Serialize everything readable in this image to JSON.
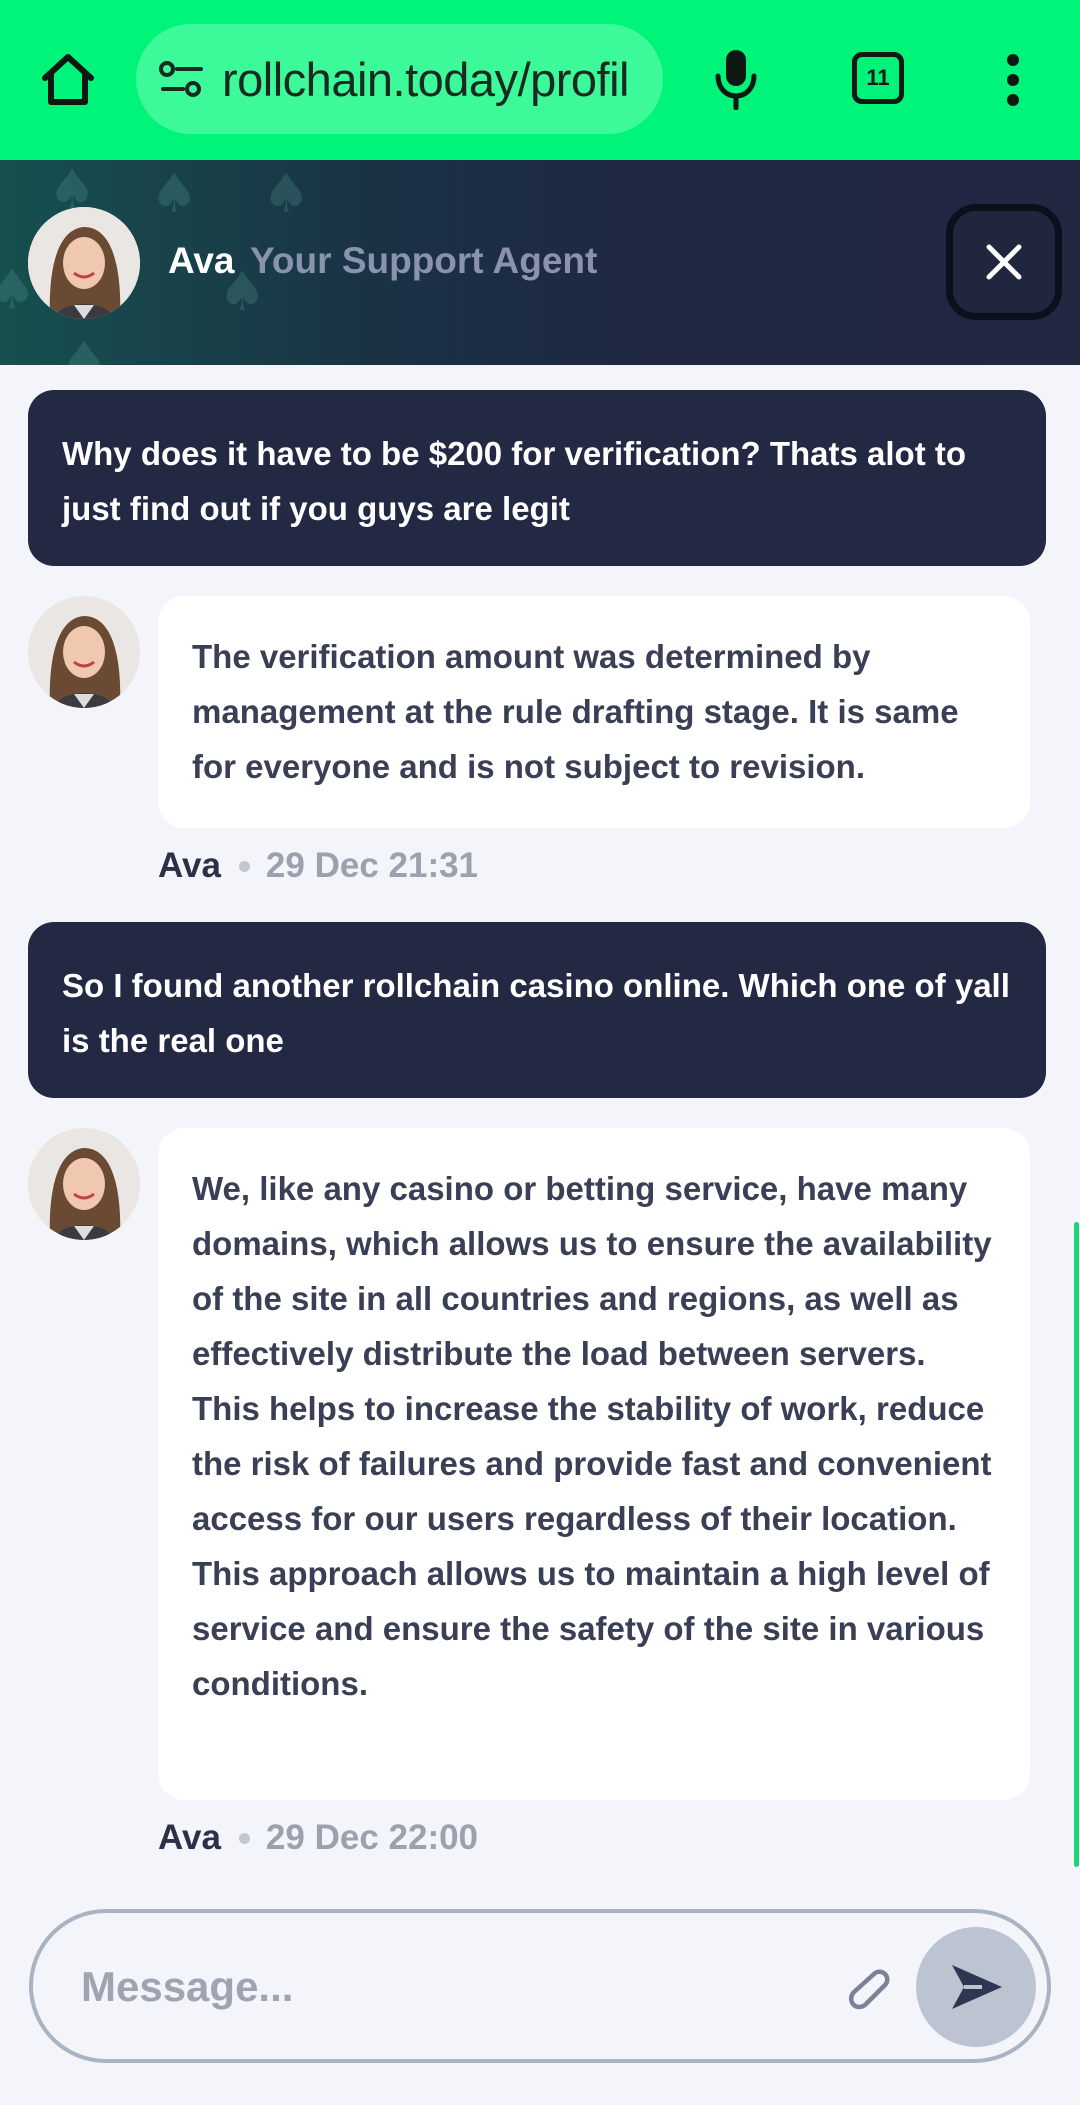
{
  "browser": {
    "url": "rollchain.today/profil",
    "tab_count": "11",
    "icons": {
      "home": "home-icon",
      "site_info": "tune-icon",
      "mic": "mic-icon",
      "menu": "kebab-menu-icon"
    }
  },
  "chat": {
    "agent_name": "Ava",
    "agent_role": "Your Support Agent",
    "messages": [
      {
        "from": "user",
        "text": "Why does it have to be $200 for verification? Thats alot to just find out if you guys are legit"
      },
      {
        "from": "agent",
        "text": "The verification amount was determined by management at the rule drafting stage. It is same for everyone and is not subject to revision.",
        "sender": "Ava",
        "time": "29 Dec 21:31"
      },
      {
        "from": "user",
        "text": "So I found another rollchain casino online. Which one of yall is the real one"
      },
      {
        "from": "agent",
        "text": "We, like any casino or betting service, have many domains, which allows us to ensure the availability of the site in all countries and regions, as well as effectively distribute the load between servers. This helps to increase the stability of work, reduce the risk of failures and provide fast and convenient access for our users regardless of their location. This approach allows us to maintain a high level of service and ensure the safety of the site in various conditions.",
        "sender": "Ava",
        "time": "29 Dec 22:00"
      }
    ]
  },
  "composer": {
    "placeholder": "Message...",
    "value": ""
  },
  "colors": {
    "browser_bar": "#00f47a",
    "user_bubble": "#232843",
    "agent_bubble": "#ffffff",
    "scroll_accent": "#1fd27a"
  }
}
